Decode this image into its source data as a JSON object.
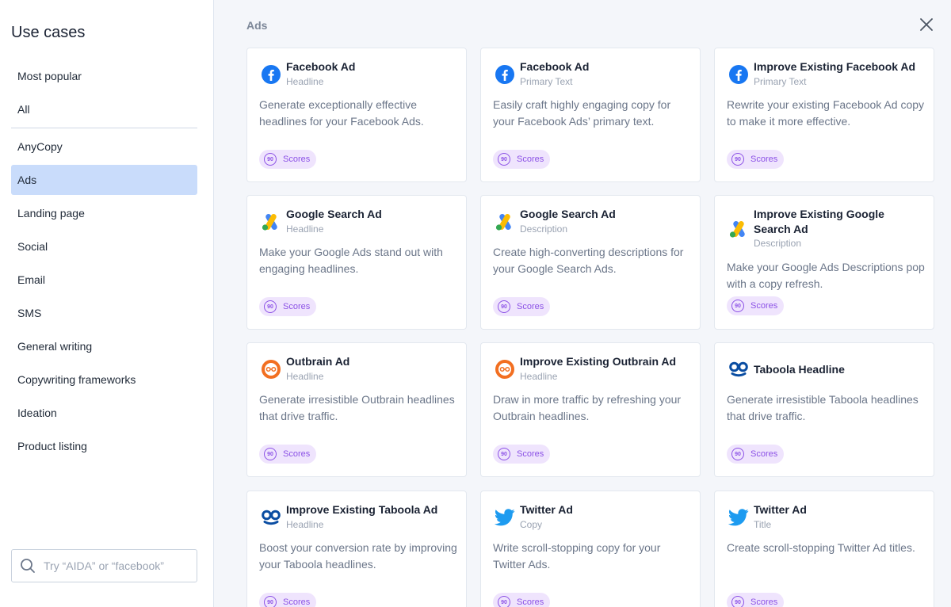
{
  "sidebar": {
    "title": "Use cases",
    "items": [
      "Most popular",
      "All",
      "AnyCopy",
      "Ads",
      "Landing page",
      "Social",
      "Email",
      "SMS",
      "General writing",
      "Copywriting frameworks",
      "Ideation",
      "Product listing"
    ],
    "active_item": "Ads",
    "search_placeholder": "Try “AIDA” or “facebook”"
  },
  "main": {
    "section_title": "Ads",
    "badge_label": "Scores",
    "badge_value": "90",
    "cards": [
      {
        "title": "Facebook Ad",
        "subtitle": "Headline",
        "description": "Generate exceptionally effective headlines for your Facebook Ads.",
        "icon": "facebook-icon"
      },
      {
        "title": "Facebook Ad",
        "subtitle": "Primary Text",
        "description": "Easily craft highly engaging copy for your Facebook Ads’ primary text.",
        "icon": "facebook-icon"
      },
      {
        "title": "Improve Existing Facebook Ad",
        "subtitle": "Primary Text",
        "description": "Rewrite your existing Facebook Ad copy to make it more effective.",
        "icon": "facebook-icon"
      },
      {
        "title": "Google Search Ad",
        "subtitle": "Headline",
        "description": "Make your Google Ads stand out with engaging headlines.",
        "icon": "google-ads-icon"
      },
      {
        "title": "Google Search Ad",
        "subtitle": "Description",
        "description": "Create high-converting descriptions for your Google Search Ads.",
        "icon": "google-ads-icon"
      },
      {
        "title": "Improve Existing Google Search Ad",
        "subtitle": "Description",
        "description": "Make your Google Ads Descriptions pop with a copy refresh.",
        "icon": "google-ads-icon"
      },
      {
        "title": "Outbrain Ad",
        "subtitle": "Headline",
        "description": "Generate irresistible Outbrain headlines that drive traffic.",
        "icon": "outbrain-icon"
      },
      {
        "title": "Improve Existing Outbrain Ad",
        "subtitle": "Headline",
        "description": "Draw in more traffic by refreshing your Outbrain headlines.",
        "icon": "outbrain-icon"
      },
      {
        "title": "Taboola Headline",
        "subtitle": "",
        "description": "Generate irresistible Taboola headlines that drive traffic.",
        "icon": "taboola-icon"
      },
      {
        "title": "Improve Existing Taboola Ad",
        "subtitle": "Headline",
        "description": "Boost your conversion rate by improving your Taboola headlines.",
        "icon": "taboola-icon"
      },
      {
        "title": "Twitter Ad",
        "subtitle": "Copy",
        "description": "Write scroll-stopping copy for your Twitter Ads.",
        "icon": "twitter-icon"
      },
      {
        "title": "Twitter Ad",
        "subtitle": "Title",
        "description": "Create scroll-stopping Twitter Ad titles.",
        "icon": "twitter-icon"
      }
    ]
  },
  "colors": {
    "active_nav": "#c9dcfb",
    "badge_bg": "#efe4fd",
    "badge_fg": "#8c52e6",
    "facebook": "#1877f2",
    "twitter": "#1d9bf0",
    "outbrain": "#f26f21",
    "taboola": "#0a4da2"
  }
}
